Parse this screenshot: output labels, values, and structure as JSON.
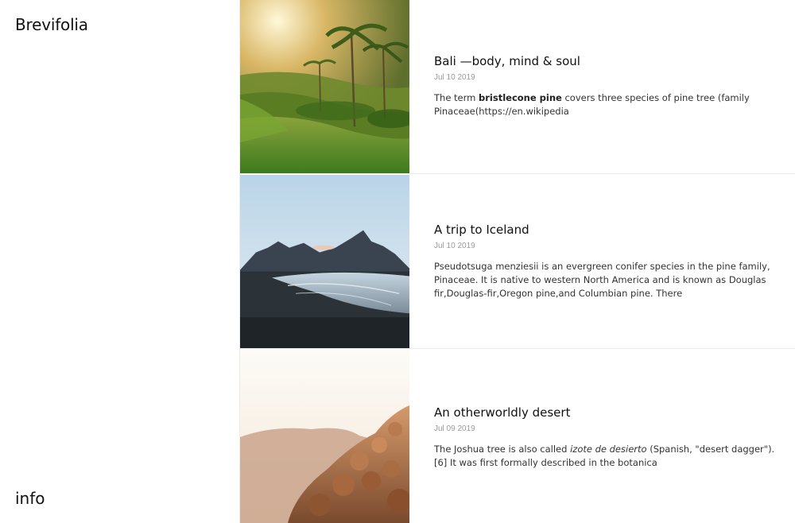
{
  "site": {
    "brand": "Brevifolia",
    "info_link": "info"
  },
  "posts": [
    {
      "title": "Bali —body, mind & soul",
      "date": "Jul 10 2019",
      "excerpt_pre": "The term ",
      "excerpt_bold": "bristlecone pine",
      "excerpt_post": " covers three species of pine tree (family Pinaceae(https://en.wikipedia",
      "image_icon": "rice-terrace-photo"
    },
    {
      "title": "A trip to Iceland",
      "date": "Jul 10 2019",
      "excerpt": "Pseudotsuga menziesii is an evergreen conifer species in the pine family, Pinaceae. It is native to western North America and is known as Douglas fir,Douglas-fir,Oregon pine,and Columbian pine. There",
      "image_icon": "iceland-mountain-beach-photo"
    },
    {
      "title": "An otherworldly desert",
      "date": "Jul 09 2019",
      "excerpt_pre": "The Joshua tree is also called ",
      "excerpt_italic": "izote de desierto",
      "excerpt_post": " (Spanish, \"desert dagger\").[6] It was first formally described in the botanica",
      "image_icon": "desert-rocks-photo"
    }
  ]
}
